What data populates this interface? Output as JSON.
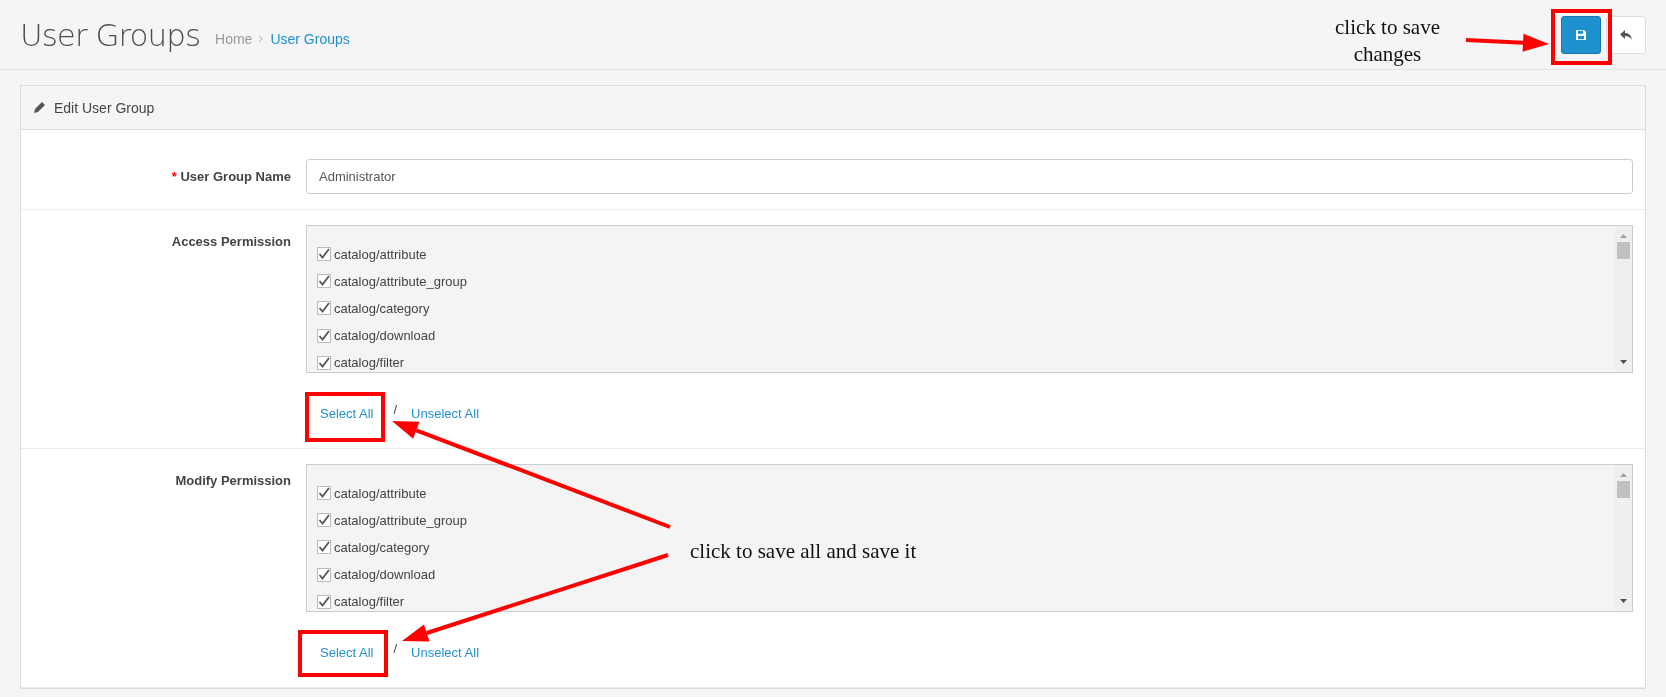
{
  "page_title": "User Groups",
  "breadcrumb": [
    {
      "label": "Home",
      "active": false
    },
    {
      "label": "User Groups",
      "active": true
    }
  ],
  "panel": {
    "title": "Edit User Group"
  },
  "form": [
    {
      "kind": "text",
      "label": "User Group Name",
      "required_mark": "*",
      "value": "Administrator"
    },
    {
      "kind": "checklist",
      "label": "Access Permission",
      "items": [
        {
          "label": "catalog/attribute",
          "checked": true
        },
        {
          "label": "catalog/attribute_group",
          "checked": true
        },
        {
          "label": "catalog/category",
          "checked": true
        },
        {
          "label": "catalog/download",
          "checked": true
        },
        {
          "label": "catalog/filter",
          "checked": true
        }
      ],
      "links": [
        "Select All",
        "Unselect All"
      ],
      "separator": "/"
    },
    {
      "kind": "checklist",
      "label": "Modify Permission",
      "items": [
        {
          "label": "catalog/attribute",
          "checked": true
        },
        {
          "label": "catalog/attribute_group",
          "checked": true
        },
        {
          "label": "catalog/category",
          "checked": true
        },
        {
          "label": "catalog/download",
          "checked": true
        },
        {
          "label": "catalog/filter",
          "checked": true
        }
      ],
      "links": [
        "Select All",
        "Unselect All"
      ],
      "separator": "/"
    }
  ],
  "annotations": [
    {
      "text": "click to save\nchanges"
    },
    {
      "text": "click to save all and save it"
    }
  ]
}
